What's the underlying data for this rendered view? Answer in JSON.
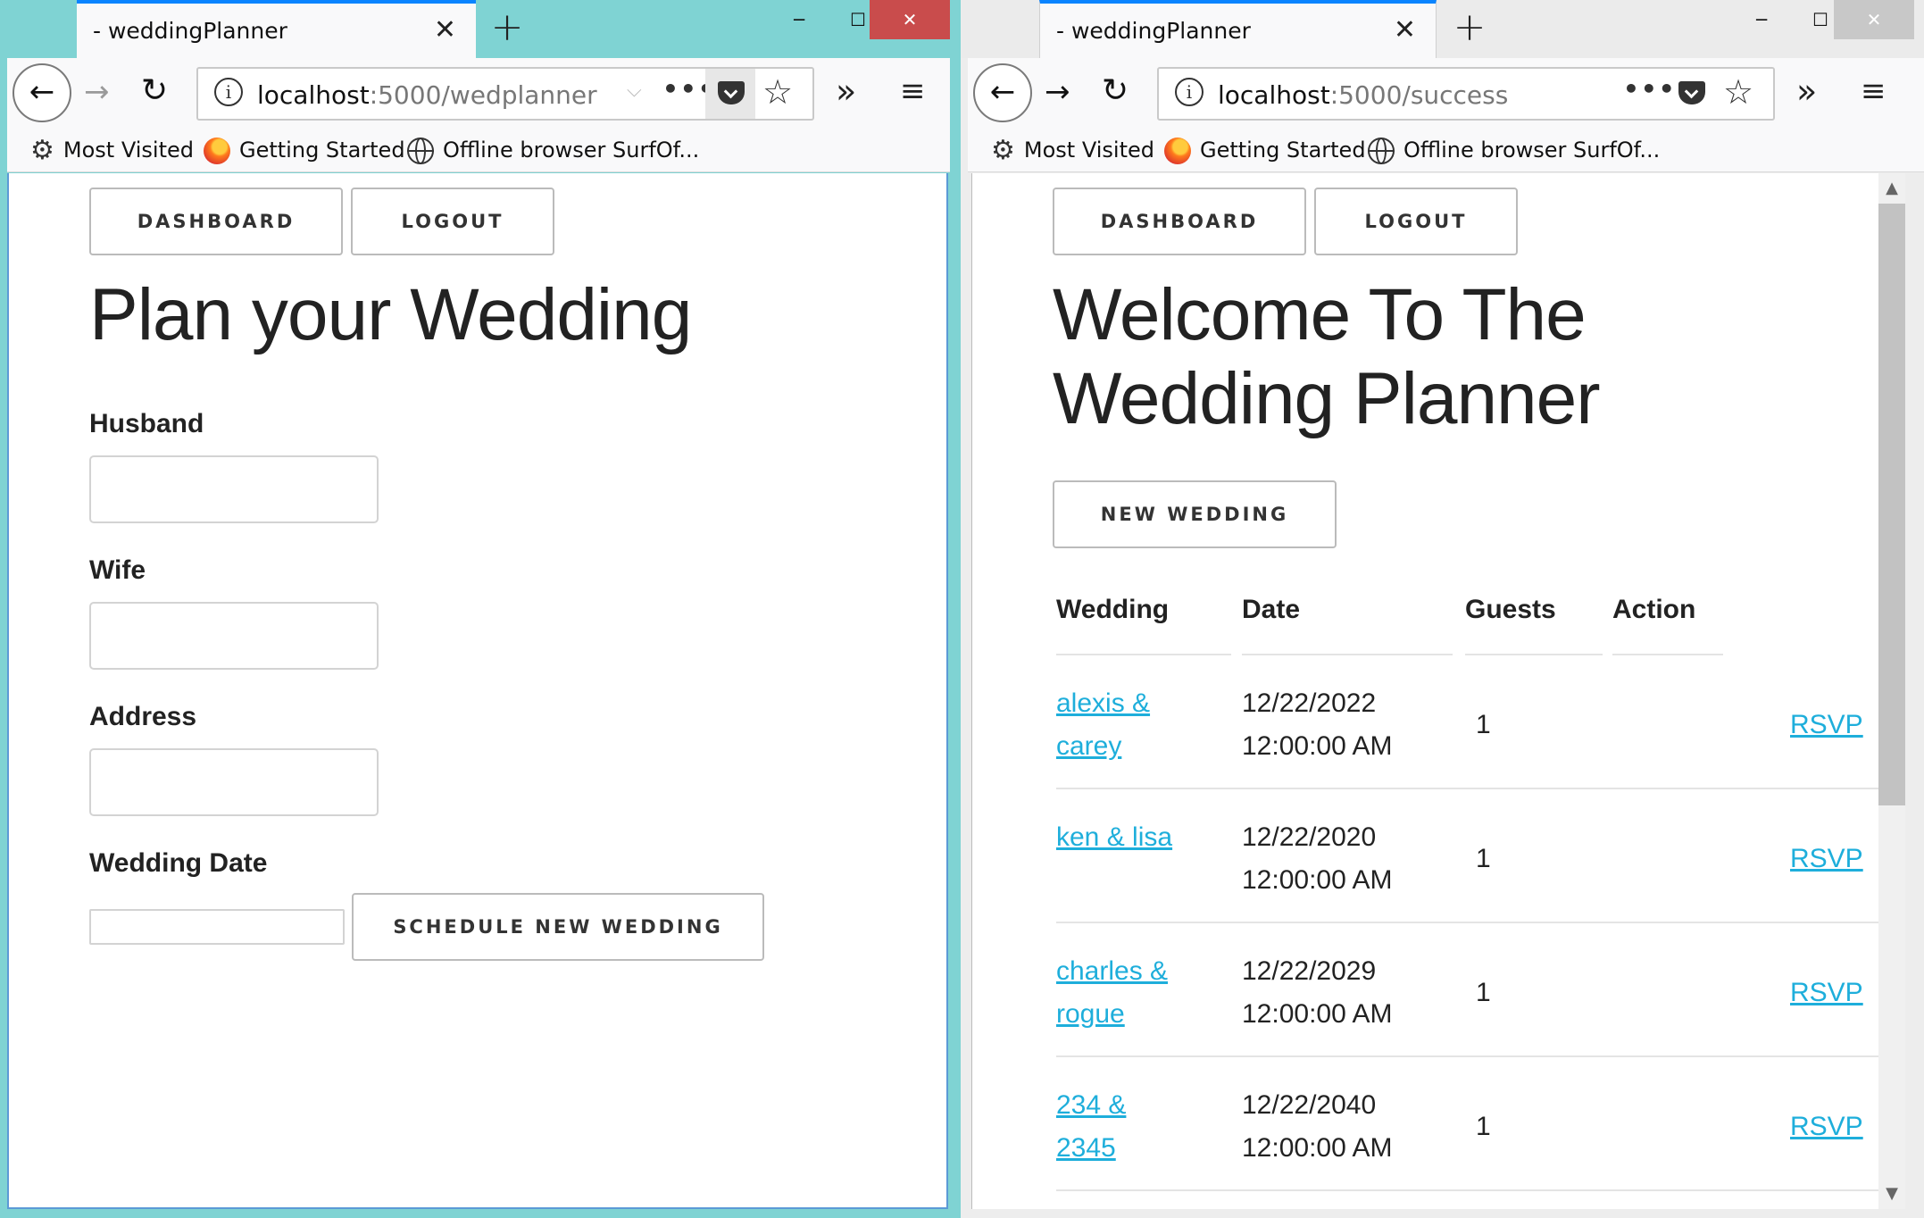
{
  "left_window": {
    "tab_title": "- weddingPlanner",
    "url_host": "localhost",
    "url_path": ":5000/wedplanner",
    "bookmarks": [
      "Most Visited",
      "Getting Started",
      "Offline browser SurfOf..."
    ],
    "buttons": {
      "dashboard": "DASHBOARD",
      "logout": "LOGOUT"
    },
    "heading": "Plan your Wedding",
    "form": {
      "husband_label": "Husband",
      "wife_label": "Wife",
      "address_label": "Address",
      "date_label": "Wedding Date",
      "husband_value": "",
      "wife_value": "",
      "address_value": "",
      "date_value": "",
      "submit_label": "SCHEDULE NEW WEDDING"
    }
  },
  "right_window": {
    "tab_title": "- weddingPlanner",
    "url_host": "localhost",
    "url_path": ":5000/success",
    "bookmarks": [
      "Most Visited",
      "Getting Started",
      "Offline browser SurfOf..."
    ],
    "buttons": {
      "dashboard": "DASHBOARD",
      "logout": "LOGOUT",
      "new_wedding": "NEW WEDDING"
    },
    "heading_line1": "Welcome To The",
    "heading_line2": "Wedding Planner",
    "table": {
      "headers": [
        "Wedding",
        "Date",
        "Guests",
        "Action"
      ],
      "rows": [
        {
          "wedding_l1": "alexis &",
          "wedding_l2": "carey",
          "date_l1": "12/22/2022",
          "date_l2": "12:00:00 AM",
          "guests": "1",
          "action": "RSVP"
        },
        {
          "wedding_l1": "ken & lisa",
          "wedding_l2": "",
          "date_l1": "12/22/2020",
          "date_l2": "12:00:00 AM",
          "guests": "1",
          "action": "RSVP"
        },
        {
          "wedding_l1": "charles &",
          "wedding_l2": "rogue",
          "date_l1": "12/22/2029",
          "date_l2": "12:00:00 AM",
          "guests": "1",
          "action": "RSVP"
        },
        {
          "wedding_l1": "234 &",
          "wedding_l2": "2345",
          "date_l1": "12/22/2040",
          "date_l2": "12:00:00 AM",
          "guests": "1",
          "action": "RSVP"
        }
      ]
    }
  },
  "icons": {
    "close": "✕",
    "new_tab": "+",
    "minimize": "─",
    "maximize": "☐",
    "back": "←",
    "forward": "→",
    "reload": "↻",
    "info": "i",
    "dots": "•••",
    "star": "☆",
    "overflow": "»",
    "menu": "≡",
    "gear": "⚙",
    "chevron": "⌵",
    "scroll_up": "▲",
    "scroll_down": "▼"
  },
  "colors": {
    "link": "#1eaedb",
    "accent": "#0a84ff",
    "close_red": "#c94c4c",
    "desktop": "#7fd3d3"
  }
}
